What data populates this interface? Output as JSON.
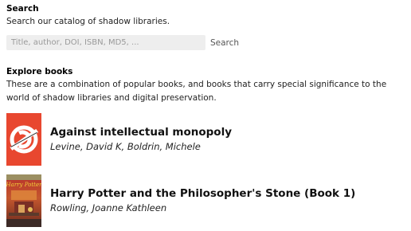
{
  "search": {
    "title": "Search",
    "description": "Search our catalog of shadow libraries.",
    "placeholder": "Title, author, DOI, ISBN, MD5, ...",
    "button_label": "Search"
  },
  "explore": {
    "title": "Explore books",
    "description": "These are a combination of popular books, and books that carry special significance to the world of shadow libraries and digital preservation."
  },
  "books": [
    {
      "title": "Against intellectual monopoly",
      "author": "Levine, David K, Boldrin, Michele"
    },
    {
      "title": "Harry Potter and the Philosopher's Stone (Book 1)",
      "author": "Rowling, Joanne Kathleen",
      "cover_text": "Harry Potter"
    }
  ],
  "colors": {
    "cover1_background": "#e8472f",
    "input_background": "#eeeeee"
  }
}
